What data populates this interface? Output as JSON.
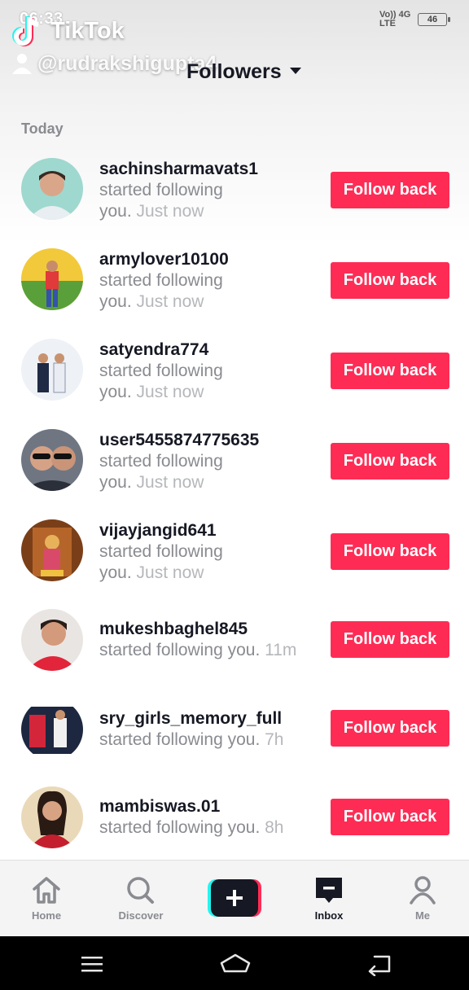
{
  "status_bar": {
    "time": "06:33",
    "network_top": "Vo)) 4G",
    "network_bottom": "LTE",
    "battery": "46"
  },
  "watermark": {
    "brand": "TikTok",
    "username": "@rudrakshigupta4"
  },
  "header": {
    "title": "Followers"
  },
  "section_label": "Today",
  "notifications": [
    {
      "username": "sachinsharmavats1",
      "desc_line1": "started following",
      "desc_line2": "you.",
      "time": "Just now",
      "button": "Follow back"
    },
    {
      "username": "armylover10100",
      "desc_line1": "started following",
      "desc_line2": "you.",
      "time": "Just now",
      "button": "Follow back"
    },
    {
      "username": "satyendra774",
      "desc_line1": "started following",
      "desc_line2": "you.",
      "time": "Just now",
      "button": "Follow back"
    },
    {
      "username": "user5455874775635",
      "desc_line1": "started following",
      "desc_line2": "you.",
      "time": "Just now",
      "button": "Follow back"
    },
    {
      "username": "vijayjangid641",
      "desc_line1": "started following",
      "desc_line2": "you.",
      "time": "Just now",
      "button": "Follow back"
    },
    {
      "username": "mukeshbaghel845",
      "desc": "started following you.",
      "time": "11m",
      "button": "Follow back"
    },
    {
      "username": "sry_girls_memory_full",
      "desc": "started following you.",
      "time": "7h",
      "button": "Follow back"
    },
    {
      "username": "mambiswas.01",
      "desc": "started following you.",
      "time": "8h",
      "button": "Follow back"
    }
  ],
  "tabbar": {
    "home": "Home",
    "discover": "Discover",
    "inbox": "Inbox",
    "me": "Me",
    "active": "inbox"
  },
  "colors": {
    "accent": "#fe2c55",
    "text_primary": "#161823",
    "text_secondary": "#8a8b91",
    "cyan": "#25f4ee"
  },
  "icons": [
    "tiktok-logo-icon",
    "user-icon",
    "caret-down-icon",
    "home-icon",
    "search-icon",
    "plus-icon",
    "inbox-icon",
    "profile-icon",
    "menu-icon",
    "home-nav-icon",
    "back-icon"
  ]
}
